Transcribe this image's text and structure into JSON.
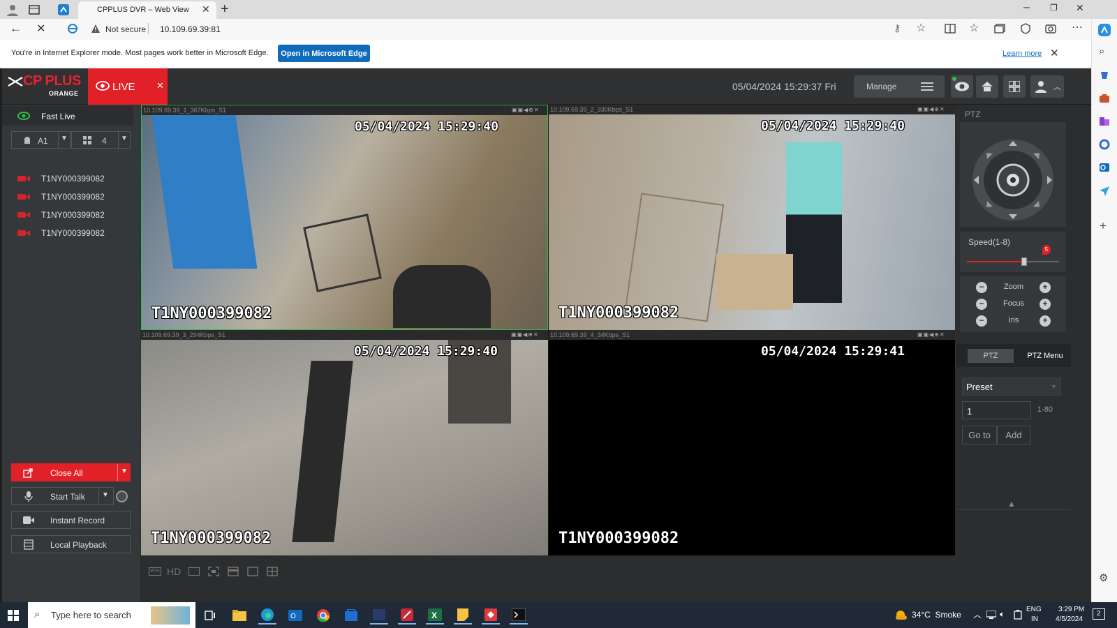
{
  "browser": {
    "tab_title": "CPPLUS DVR – Web View",
    "security_label": "Not secure",
    "url": "10.109.69.39:81",
    "ie_message": "You're in Internet Explorer mode. Most pages work better in Microsoft Edge.",
    "open_edge_label": "Open in Microsoft Edge",
    "learn_more_label": "Learn more"
  },
  "app": {
    "logo_text": "CP PLUS",
    "logo_sub": "ORANGE",
    "live_label": "LIVE",
    "datetime": "05/04/2024 15:29:37 Fri",
    "manage_label": "Manage"
  },
  "left": {
    "fast_live_label": "Fast Live",
    "stream_label": "A1",
    "split_label": "4",
    "channels": [
      "T1NY000399082",
      "T1NY000399082",
      "T1NY000399082",
      "T1NY000399082"
    ],
    "close_all_label": "Close All",
    "start_talk_label": "Start Talk",
    "instant_record_label": "Instant Record",
    "local_playback_label": "Local Playback"
  },
  "cameras": [
    {
      "info": "10.109.69.39_1_367Kbps_S1",
      "timestamp": "05/04/2024 15:29:40",
      "name": "T1NY000399082"
    },
    {
      "info": "10.109.69.39_2_330Kbps_S1",
      "timestamp": "05/04/2024 15:29:40",
      "name": "T1NY000399082"
    },
    {
      "info": "10.109.69.39_3_294Kbps_S1",
      "timestamp": "05/04/2024 15:29:40",
      "name": "T1NY000399082"
    },
    {
      "info": "10.109.69.39_4_34Kbps_S1",
      "timestamp": "05/04/2024 15:29:41",
      "name": "T1NY000399082"
    }
  ],
  "bottom_toolbar": {
    "hd_label": "HD"
  },
  "ptz": {
    "title": "PTZ",
    "speed_label": "Speed(1-8)",
    "speed_value": "5",
    "speed_fraction": 0.62,
    "zoom_label": "Zoom",
    "focus_label": "Focus",
    "iris_label": "Iris",
    "tab_ptz": "PTZ",
    "tab_ptz_menu": "PTZ Menu",
    "preset_label": "Preset",
    "preset_value": "1",
    "preset_range": "1-80",
    "goto_label": "Go to",
    "add_label": "Add"
  },
  "taskbar": {
    "search_placeholder": "Type here to search",
    "weather": "34°C  Smoke",
    "lang_top": "ENG",
    "lang_bottom": "IN",
    "time": "3:29 PM",
    "date": "4/5/2024",
    "notif_count": "2"
  }
}
